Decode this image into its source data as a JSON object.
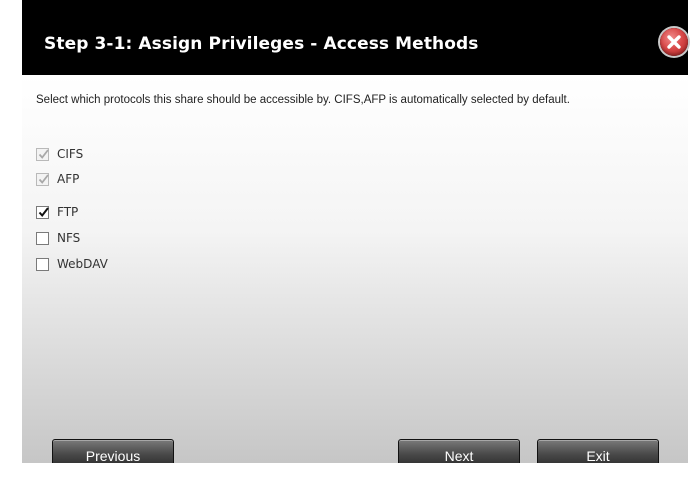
{
  "dialog": {
    "title": "Step 3-1: Assign Privileges - Access Methods",
    "description": "Select which protocols this share should be accessible by. CIFS,AFP is automatically selected by default."
  },
  "protocols": [
    {
      "label": "CIFS",
      "checked": true,
      "disabled": true
    },
    {
      "label": "AFP",
      "checked": true,
      "disabled": true
    },
    {
      "label": "FTP",
      "checked": true,
      "disabled": false
    },
    {
      "label": "NFS",
      "checked": false,
      "disabled": false
    },
    {
      "label": "WebDAV",
      "checked": false,
      "disabled": false
    }
  ],
  "buttons": {
    "previous_label": "Previous",
    "next_label": "Next",
    "exit_label": "Exit"
  },
  "colors": {
    "title_bar": "#000000",
    "close_button": "#d84848",
    "button_dark": "#4a4a4a"
  },
  "icons": {
    "close": "close-icon",
    "checkmark": "checkmark-icon"
  }
}
